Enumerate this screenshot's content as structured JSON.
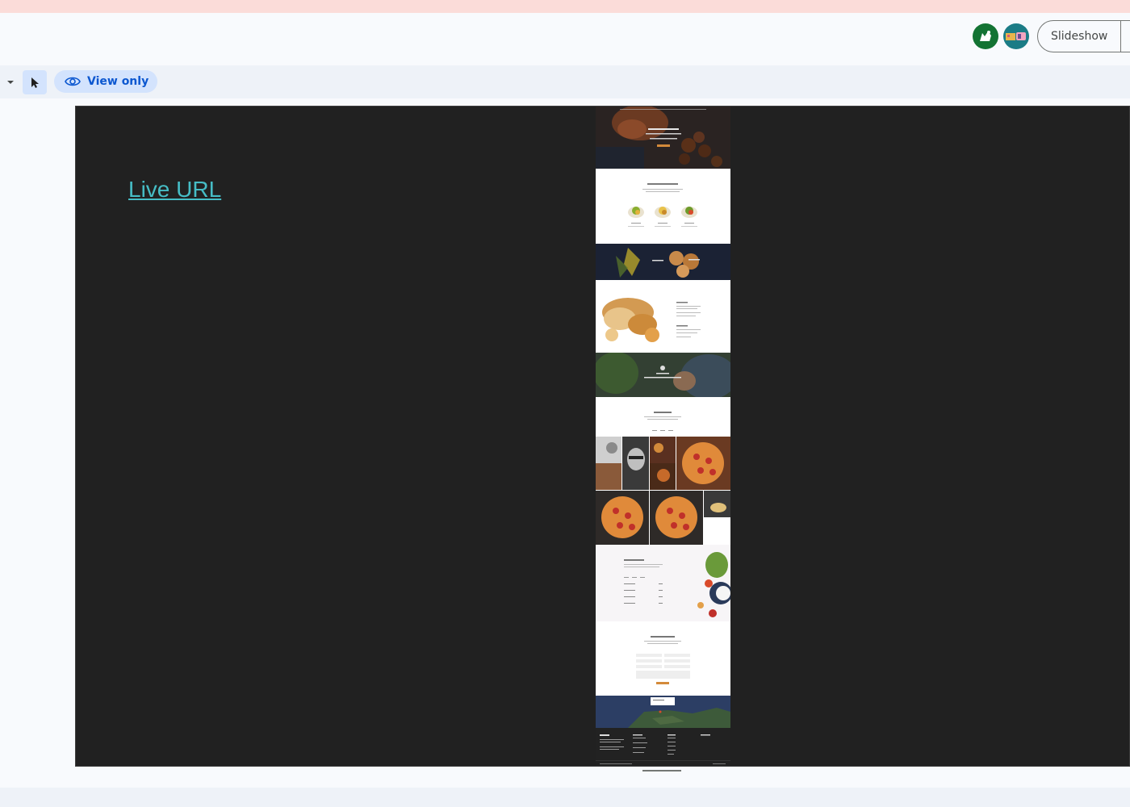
{
  "header": {
    "slideshow_label": "Slideshow"
  },
  "toolbar": {
    "mode_label": "View only"
  },
  "slide": {
    "link_text": "Live URL"
  },
  "colors": {
    "banner": "#fbdcd9",
    "chip": "#d3e3fd",
    "chip_text": "#0b57d0",
    "slide_bg": "#212121",
    "link": "#46bdc6",
    "accent_orange": "#d38a3a"
  }
}
